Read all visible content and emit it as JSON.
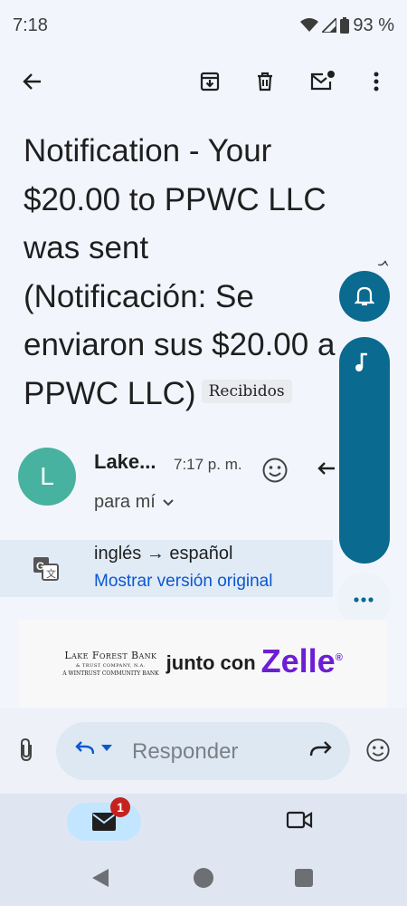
{
  "status_bar": {
    "time": "7:18",
    "battery": "93 %"
  },
  "toolbar": {
    "back_icon": "arrow-left-icon",
    "archive_icon": "archive-icon",
    "delete_icon": "trash-icon",
    "unread_icon": "mark-unread-icon",
    "more_icon": "more-vert-icon"
  },
  "email": {
    "subject": "Notification - Your $20.00 to PPWC LLC was sent (Notificación: Se enviaron sus $20.00 a PPWC LLC)",
    "label_chip": "Recibidos",
    "sender_initial": "L",
    "sender_name": "Lake...",
    "time": "7:17 p. m.",
    "recipient": "para mí"
  },
  "translation": {
    "languages": "inglés → español",
    "show_original_link": "Mostrar versión original"
  },
  "banner": {
    "bank_name": "Lake Forest Bank",
    "bank_sub": "& TRUST COMPANY, N.A.",
    "bank_sub2": "A WINTRUST COMMUNITY BANK",
    "junto": "junto con",
    "zelle": "Zelle",
    "zelle_reg": "®"
  },
  "compose": {
    "placeholder": "Responder"
  },
  "bottom_nav": {
    "mail_badge": "1"
  },
  "colors": {
    "accent_teal": "#0b6a8f",
    "avatar": "#47b29f",
    "link": "#0b57d0",
    "zelle": "#6d1ed4",
    "badge": "#c5221f"
  }
}
